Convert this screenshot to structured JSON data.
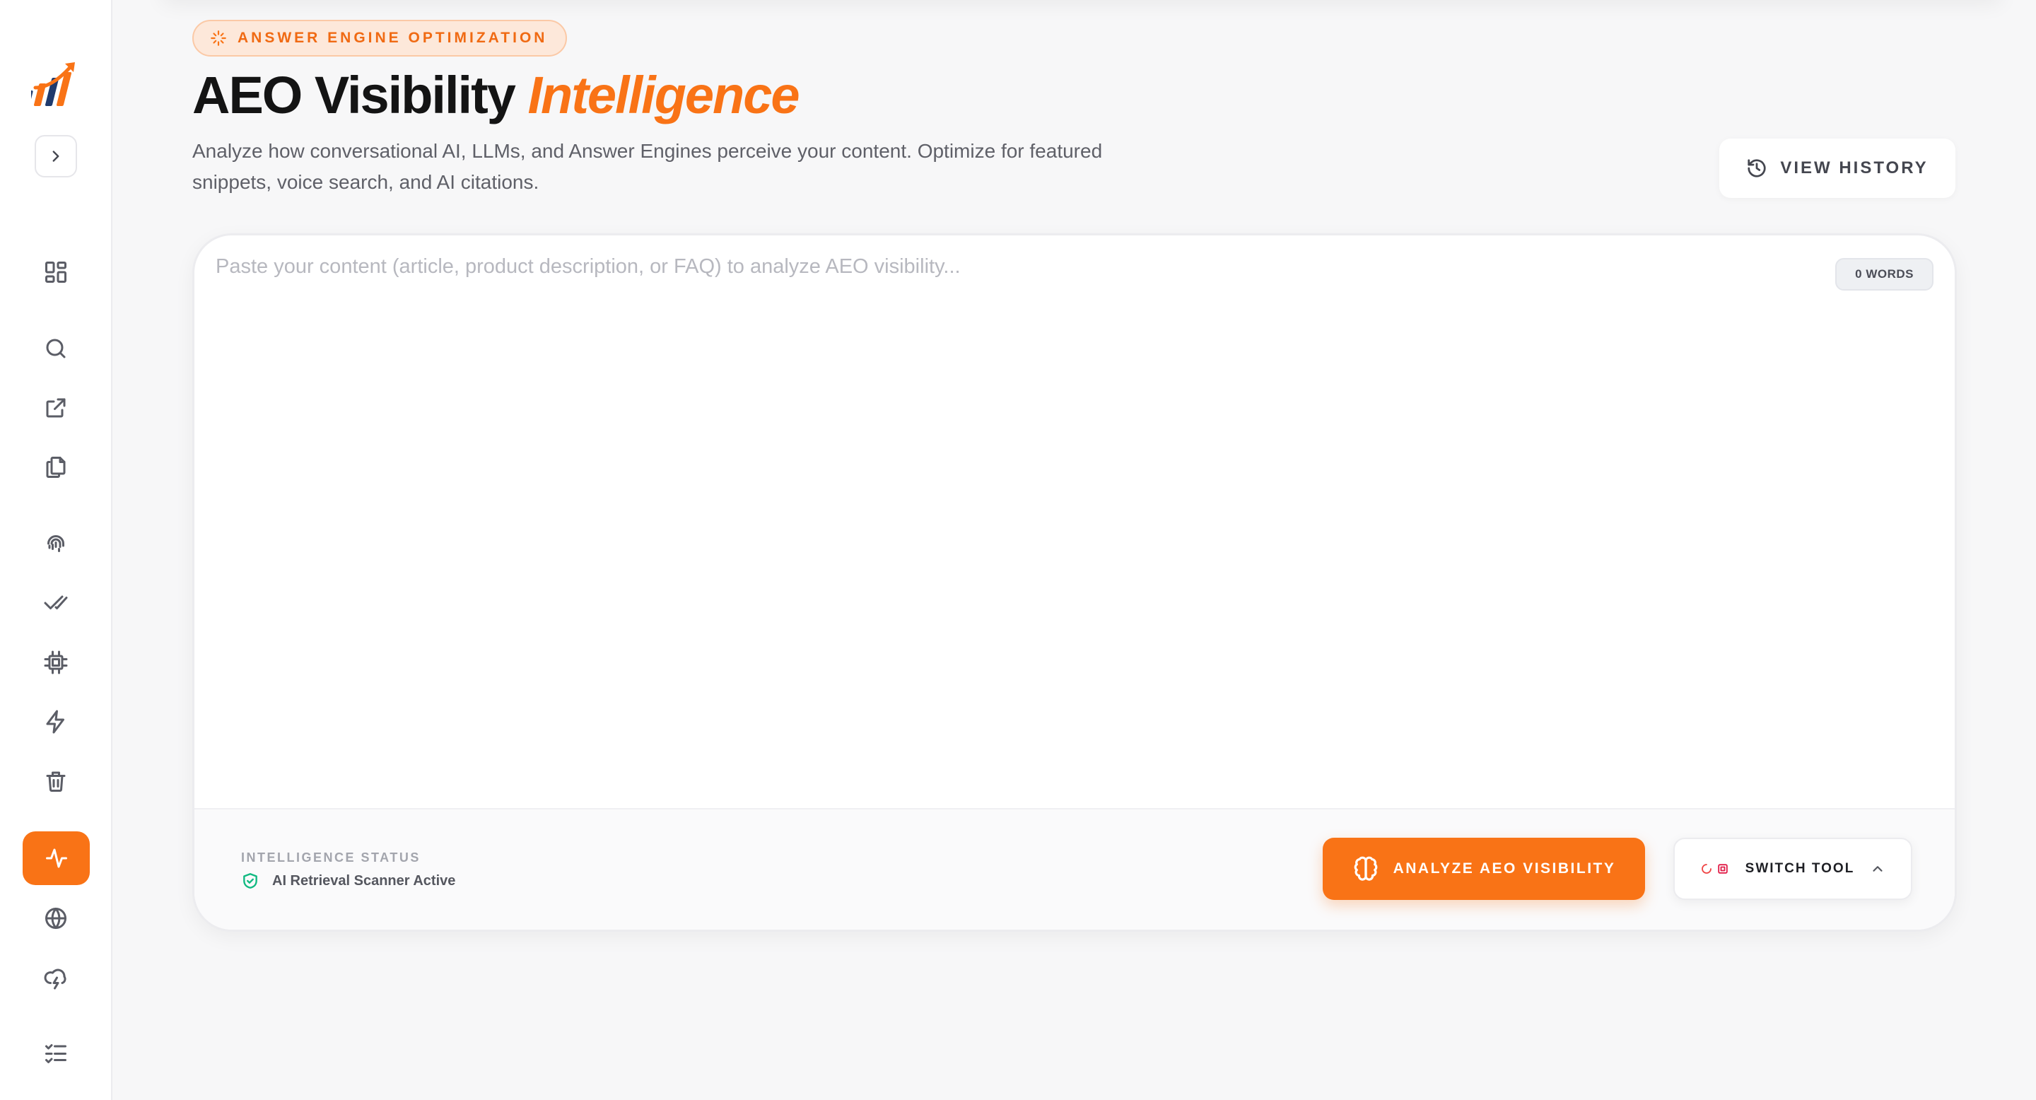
{
  "header": {
    "badge_label": "ANSWER ENGINE OPTIMIZATION",
    "title_main": "AEO Visibility",
    "title_accent": "Intelligence",
    "description": "Analyze how conversational AI, LLMs, and Answer Engines perceive your content. Optimize for featured snippets, voice search, and AI citations.",
    "history_button": "VIEW HISTORY"
  },
  "editor": {
    "placeholder": "Paste your content (article, product description, or FAQ) to analyze AEO visibility...",
    "value": "",
    "word_count": "0 WORDS"
  },
  "footer": {
    "status_label": "INTELLIGENCE STATUS",
    "status_text": "AI Retrieval Scanner Active",
    "analyze_button": "ANALYZE AEO VISIBILITY",
    "switch_button": "SWITCH TOOL"
  },
  "sidebar": {
    "items": [
      {
        "icon": "dashboard-grid-icon"
      },
      {
        "icon": "search-icon"
      },
      {
        "icon": "external-link-icon"
      },
      {
        "icon": "copy-files-icon"
      },
      {
        "icon": "fingerprint-icon"
      },
      {
        "icon": "double-check-icon"
      },
      {
        "icon": "cpu-chip-icon"
      },
      {
        "icon": "lightning-icon"
      },
      {
        "icon": "trash-icon"
      },
      {
        "icon": "activity-pulse-icon",
        "active": true
      },
      {
        "icon": "globe-icon"
      },
      {
        "icon": "cloud-lightning-icon"
      },
      {
        "icon": "checklist-icon"
      }
    ]
  },
  "colors": {
    "accent": "#f97316",
    "status_ok": "#10b981",
    "background": "#f7f7f8"
  }
}
